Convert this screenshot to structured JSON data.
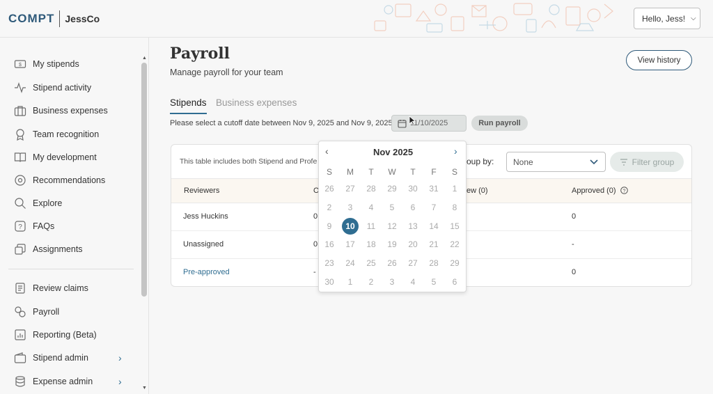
{
  "header": {
    "logo_text": "COMPT",
    "company": "JessCo",
    "greeting": "Hello, Jess!"
  },
  "sidebar": {
    "items": [
      {
        "label": "My stipends",
        "icon": "money-icon"
      },
      {
        "label": "Stipend activity",
        "icon": "activity-icon"
      },
      {
        "label": "Business expenses",
        "icon": "briefcase-icon"
      },
      {
        "label": "Team recognition",
        "icon": "award-icon"
      },
      {
        "label": "My development",
        "icon": "book-icon"
      },
      {
        "label": "Recommendations",
        "icon": "compass-icon"
      },
      {
        "label": "Explore",
        "icon": "search-icon"
      },
      {
        "label": "FAQs",
        "icon": "question-icon"
      },
      {
        "label": "Assignments",
        "icon": "assignment-icon"
      },
      {
        "label": "Review claims",
        "icon": "clipboard-icon"
      },
      {
        "label": "Payroll",
        "icon": "payroll-icon"
      },
      {
        "label": "Reporting (Beta)",
        "icon": "chart-icon"
      },
      {
        "label": "Stipend admin",
        "icon": "wallet-icon"
      },
      {
        "label": "Expense admin",
        "icon": "database-icon"
      }
    ]
  },
  "main": {
    "title": "Payroll",
    "subtitle": "Manage payroll for your team",
    "view_history": "View history",
    "tabs": [
      {
        "label": "Stipends",
        "active": true
      },
      {
        "label": "Business expenses",
        "active": false
      }
    ],
    "cutoff_text": "Please select a cutoff date between Nov 9, 2025 and Nov 9, 2025",
    "date_value": "11/10/2025",
    "run_payroll": "Run payroll"
  },
  "table": {
    "info": "This table includes both Stipend and Profe",
    "group_by_label": "roup by:",
    "group_by_value": "None",
    "filter_label": "Filter group",
    "columns": [
      "Reviewers",
      "O",
      "ew (0)",
      "Approved (0)"
    ],
    "rows": [
      {
        "reviewer": "Jess Huckins",
        "col2": "0",
        "approved": "0"
      },
      {
        "reviewer": "Unassigned",
        "col2": "0",
        "approved": "-"
      },
      {
        "reviewer": "Pre-approved",
        "col2": "-",
        "approved": "0"
      }
    ]
  },
  "datepicker": {
    "month_label": "Nov 2025",
    "weekdays": [
      "S",
      "M",
      "T",
      "W",
      "T",
      "F",
      "S"
    ],
    "weeks": [
      [
        "26",
        "27",
        "28",
        "29",
        "30",
        "31",
        "1"
      ],
      [
        "2",
        "3",
        "4",
        "5",
        "6",
        "7",
        "8"
      ],
      [
        "9",
        "10",
        "11",
        "12",
        "13",
        "14",
        "15"
      ],
      [
        "16",
        "17",
        "18",
        "19",
        "20",
        "21",
        "22"
      ],
      [
        "23",
        "24",
        "25",
        "26",
        "27",
        "28",
        "29"
      ],
      [
        "30",
        "1",
        "2",
        "3",
        "4",
        "5",
        "6"
      ]
    ],
    "selected": "10"
  },
  "colors": {
    "accent": "#2f6d91",
    "brand": "#2f5a7a"
  }
}
